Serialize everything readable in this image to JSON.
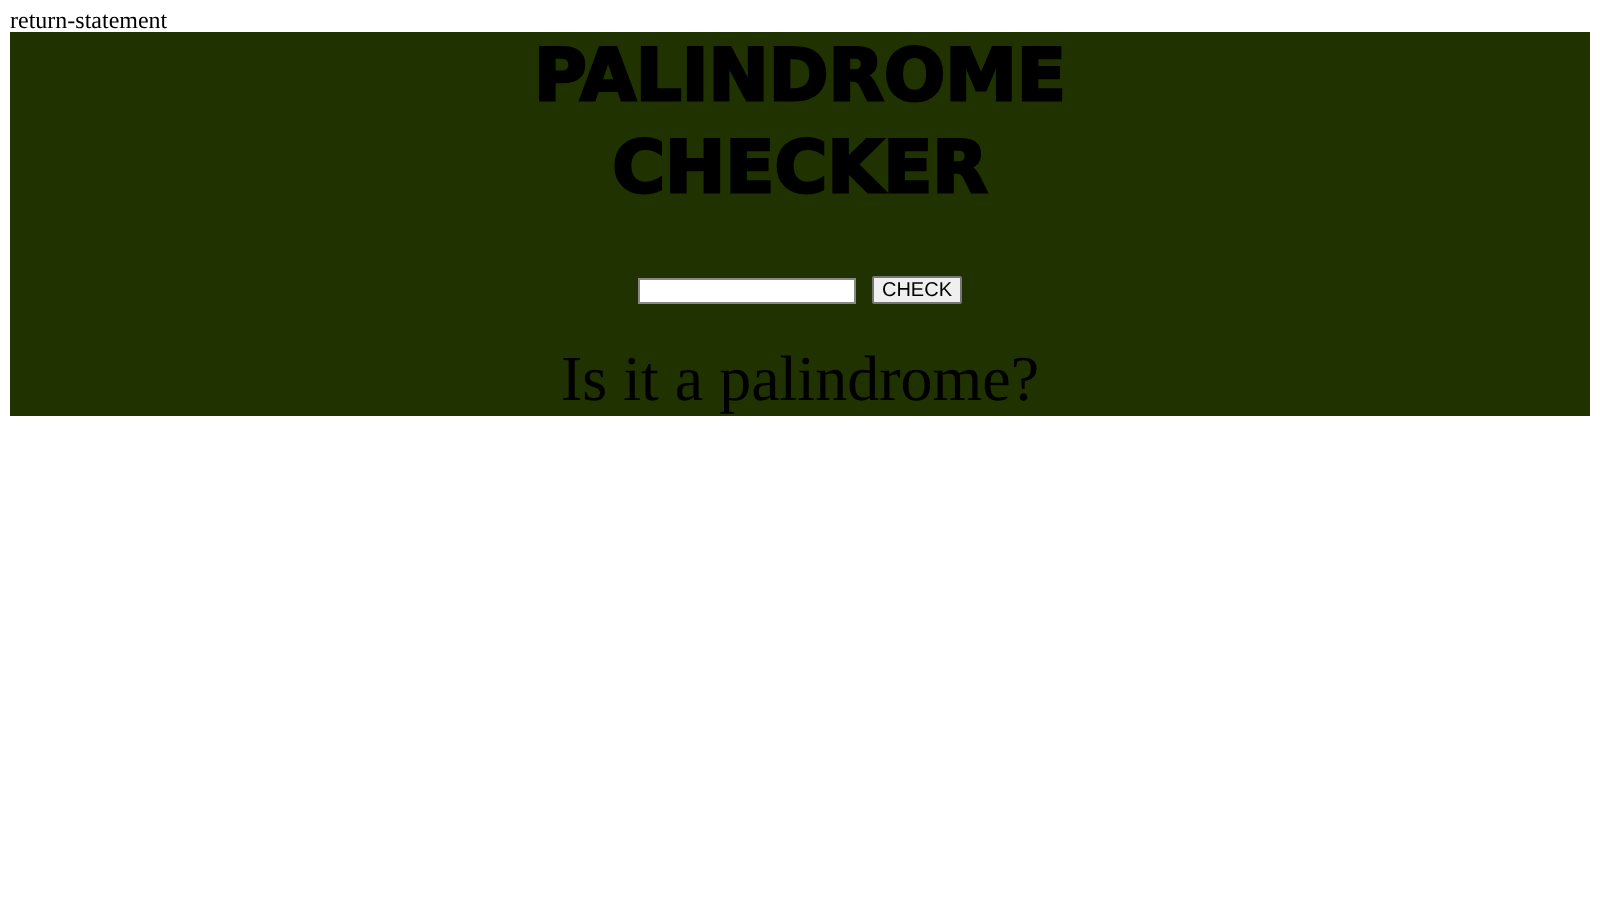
{
  "label": "return-statement",
  "title_lines": [
    "PALINDROME",
    "CHECKER"
  ],
  "button": "CHECK",
  "result": "Is it a palindrome?"
}
